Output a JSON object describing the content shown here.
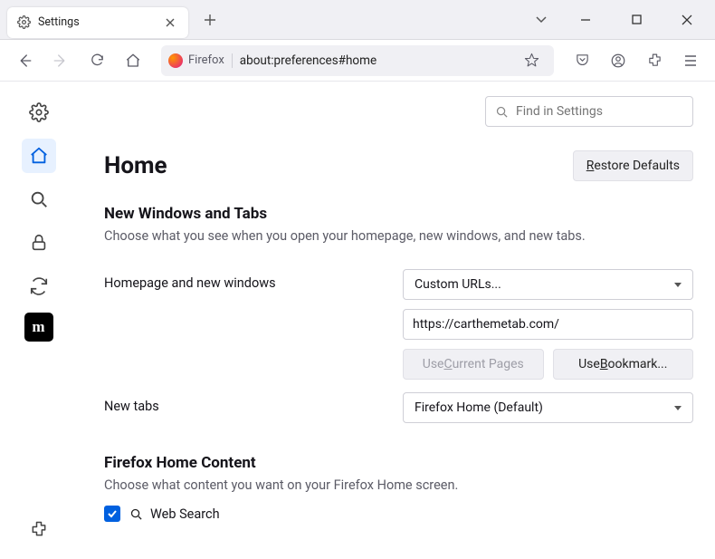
{
  "tab": {
    "label": "Settings"
  },
  "urlbar": {
    "identity": "Firefox",
    "address": "about:preferences#home"
  },
  "search_settings": {
    "placeholder": "Find in Settings"
  },
  "page": {
    "title": "Home",
    "restore": "estore Defaults"
  },
  "section_windows_tabs": {
    "title": "New Windows and Tabs",
    "desc": "Choose what you see when you open your homepage, new windows, and new tabs.",
    "homepage_label": "Homepage and new windows",
    "homepage_select": "Custom URLs...",
    "homepage_url": "https://carthemetab.com/",
    "use_current_pre": "Use ",
    "use_current_ul": "C",
    "use_current_post": "urrent Pages",
    "use_bookmark_pre": "Use ",
    "use_bookmark_ul": "B",
    "use_bookmark_post": "ookmark...",
    "newtabs_label": "New tabs",
    "newtabs_select": "Firefox Home (Default)"
  },
  "section_home_content": {
    "title": "Firefox Home Content",
    "desc": "Choose what content you want on your Firefox Home screen.",
    "web_search": "Web Search"
  }
}
